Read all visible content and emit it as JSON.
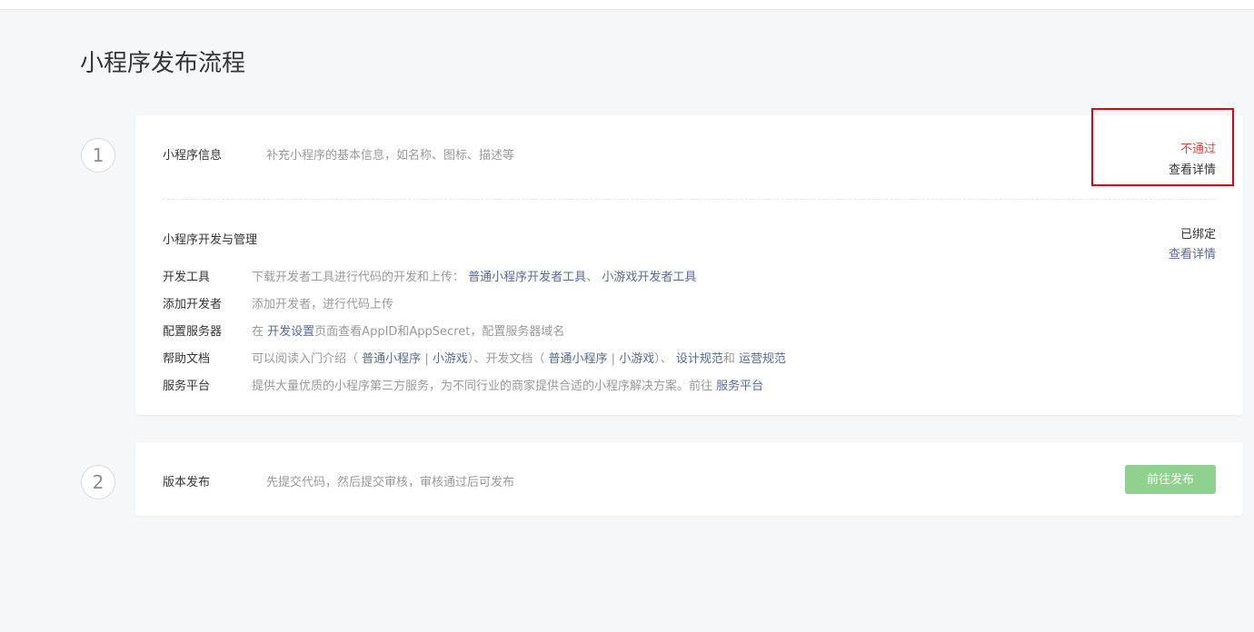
{
  "page": {
    "title": "小程序发布流程"
  },
  "steps": [
    {
      "number": "1"
    },
    {
      "number": "2"
    }
  ],
  "step1": {
    "info": {
      "title": "小程序信息",
      "desc": "补充小程序的基本信息，如名称、图标、描述等",
      "status": "不通过",
      "detail_link": "查看详情"
    },
    "dev": {
      "title": "小程序开发与管理",
      "status": "已绑定",
      "detail_link": "查看详情",
      "rows": {
        "tools": {
          "label": "开发工具",
          "text": "下载开发者工具进行代码的开发和上传：",
          "link1": "普通小程序开发者工具",
          "sep": "、",
          "link2": "小游戏开发者工具"
        },
        "developers": {
          "label": "添加开发者",
          "text": "添加开发者，进行代码上传"
        },
        "server": {
          "label": "配置服务器",
          "pre": "在",
          "link": "开发设置",
          "post": "页面查看AppID和AppSecret，配置服务器域名"
        },
        "docs": {
          "label": "帮助文档",
          "text1": "可以阅读入门介绍（",
          "link1": "普通小程序",
          "bar1": "|",
          "link2": "小游戏",
          "text2": "）、开发文档（",
          "link3": "普通小程序",
          "bar2": "|",
          "link4": "小游戏",
          "text3": "）、",
          "link5": "设计规范",
          "text4": "和",
          "link6": "运营规范"
        },
        "platform": {
          "label": "服务平台",
          "text": "提供大量优质的小程序第三方服务，为不同行业的商家提供合适的小程序解决方案。前往",
          "link": "服务平台"
        }
      }
    }
  },
  "step2": {
    "title": "版本发布",
    "desc": "先提交代码，然后提交审核，审核通过后可发布",
    "button": "前往发布"
  },
  "colors": {
    "link": "#576b95",
    "fail": "#e64340",
    "highlight_border": "#e60012",
    "button_disabled": "#8fd28f"
  }
}
